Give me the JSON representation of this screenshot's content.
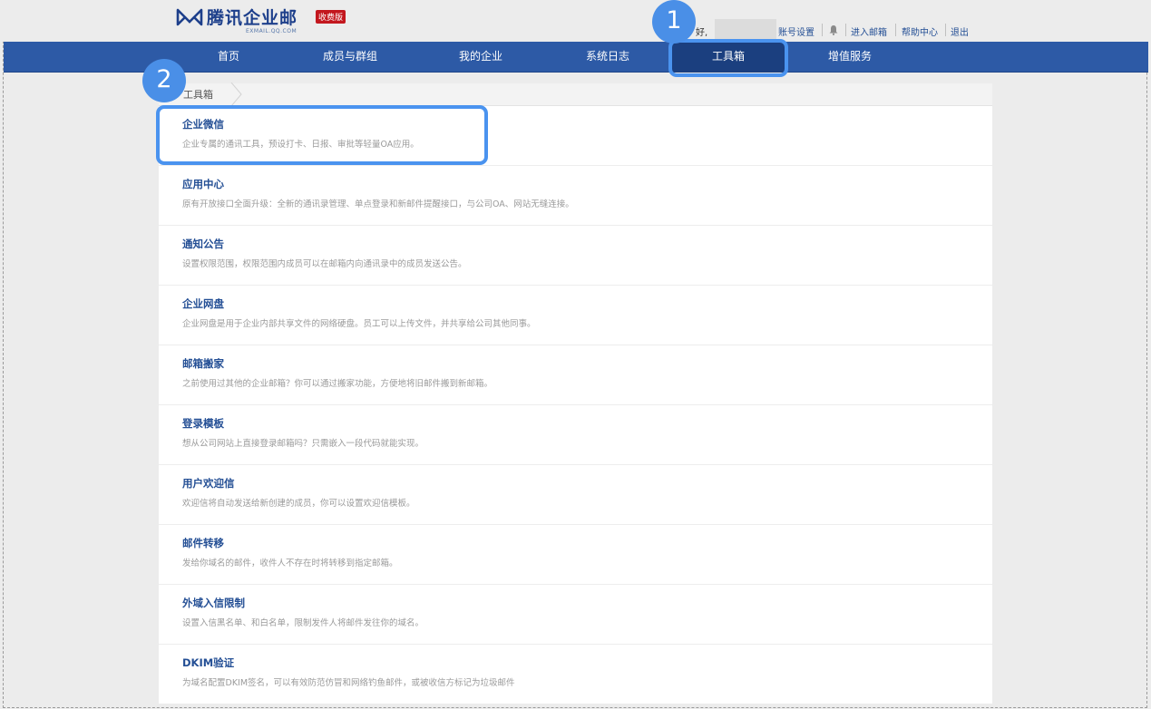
{
  "brand": {
    "name": "腾讯企业邮",
    "badge": "收费版",
    "subtitle": "EXMAIL.QQ.COM"
  },
  "top_links": {
    "greeting": "好,",
    "account_settings": "账号设置",
    "enter_mailbox": "进入邮箱",
    "help_center": "帮助中心",
    "logout": "退出"
  },
  "nav": {
    "items": [
      "首页",
      "成员与群组",
      "我的企业",
      "系统日志",
      "工具箱",
      "增值服务"
    ],
    "active": "工具箱"
  },
  "callouts": [
    "1",
    "2"
  ],
  "breadcrumb": "工具箱",
  "tools": [
    {
      "title": "企业微信",
      "desc": "企业专属的通讯工具，预设打卡、日报、审批等轻量OA应用。"
    },
    {
      "title": "应用中心",
      "desc": "原有开放接口全面升级：全新的通讯录管理、单点登录和新邮件提醒接口，与公司OA、网站无缝连接。"
    },
    {
      "title": "通知公告",
      "desc": "设置权限范围，权限范围内成员可以在邮箱内向通讯录中的成员发送公告。"
    },
    {
      "title": "企业网盘",
      "desc": "企业网盘是用于企业内部共享文件的网络硬盘。员工可以上传文件，并共享给公司其他同事。"
    },
    {
      "title": "邮箱搬家",
      "desc": "之前使用过其他的企业邮箱？你可以通过搬家功能，方便地将旧邮件搬到新邮箱。"
    },
    {
      "title": "登录模板",
      "desc": "想从公司网站上直接登录邮箱吗？只需嵌入一段代码就能实现。"
    },
    {
      "title": "用户欢迎信",
      "desc": "欢迎信将自动发送给新创建的成员，你可以设置欢迎信模板。"
    },
    {
      "title": "邮件转移",
      "desc": "发给你域名的邮件，收件人不存在时将转移到指定邮箱。"
    },
    {
      "title": "外域入信限制",
      "desc": "设置入信黑名单、和白名单，限制发件人将邮件发往你的域名。"
    },
    {
      "title": "DKIM验证",
      "desc": "为域名配置DKIM签名，可以有效防范仿冒和网络钓鱼邮件，或被收信方标记为垃圾邮件"
    }
  ],
  "colors": {
    "nav_bg": "#2d5aa6",
    "nav_active": "#1b3f7f",
    "highlight": "#4a93ef",
    "title_link": "#244f95"
  }
}
